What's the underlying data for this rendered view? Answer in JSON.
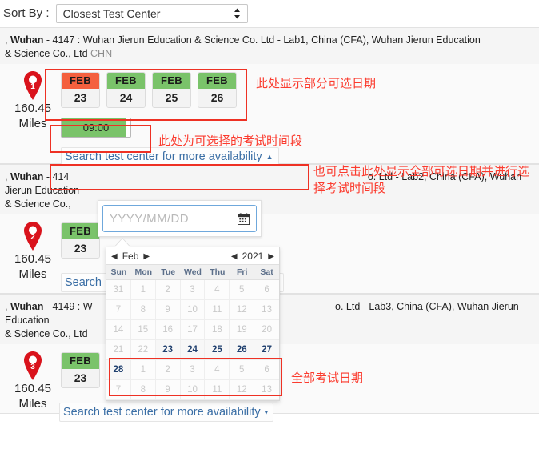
{
  "sort": {
    "label": "Sort By :",
    "selected": "Closest Test Center",
    "options": [
      "Closest Test Center"
    ]
  },
  "centers": [
    {
      "prefix": ", ",
      "city": "Wuhan",
      "code": "4147",
      "name_line1": " - 4147 : Wuhan Jierun Education & Science Co. Ltd - Lab1, China (CFA), Wuhan Jierun Education",
      "name_line2": "& Science Co., Ltd ",
      "country": "CHN",
      "pin_number": "1",
      "distance": "160.45",
      "distance_unit": "Miles",
      "dates": [
        {
          "month": "FEB",
          "day": "23",
          "state": "selected"
        },
        {
          "month": "FEB",
          "day": "24",
          "state": "available"
        },
        {
          "month": "FEB",
          "day": "25",
          "state": "available"
        },
        {
          "month": "FEB",
          "day": "26",
          "state": "available"
        }
      ],
      "times": [
        {
          "label": "09:00",
          "state": "available"
        }
      ],
      "availability_link": "Search test center for more availability",
      "caret": "▲"
    },
    {
      "prefix": ", ",
      "city": "Wuhan",
      "code": "414",
      "name_line1": " - 414",
      "name_line1_tail": "o. Ltd - Lab2, China (CFA), Wuhan Jierun Education",
      "name_line2": "& Science Co., ",
      "pin_number": "2",
      "distance": "160.45",
      "distance_unit": "Miles",
      "dates": [
        {
          "month": "FEB",
          "day": "23",
          "state": "available"
        }
      ],
      "availability_link_partial_left": "Search",
      "availability_link_partial_right": "ty",
      "caret": "▾"
    },
    {
      "prefix": ", ",
      "city": "Wuhan",
      "code": "4149",
      "name_line1": " - 4149 : W",
      "name_line1_tail": "o. Ltd - Lab3, China (CFA), Wuhan Jierun Education",
      "name_line2": "& Science Co., Ltd ",
      "pin_number": "3",
      "distance": "160.45",
      "distance_unit": "Miles",
      "dates": [
        {
          "month": "FEB",
          "day": "23",
          "state": "available"
        }
      ],
      "availability_link": "Search test center for more availability",
      "caret": "▾"
    }
  ],
  "datepicker": {
    "placeholder": "YYYY/MM/DD",
    "value": "",
    "calendar_icon": "calendar-icon",
    "month": "Feb",
    "year": "2021",
    "prev_month_arrow": "◀",
    "next_month_arrow": "▶",
    "prev_year_arrow": "◀",
    "next_year_arrow": "▶",
    "weekdays": [
      "Sun",
      "Mon",
      "Tue",
      "Wed",
      "Thu",
      "Fri",
      "Sat"
    ],
    "weeks": [
      [
        {
          "d": "31",
          "on": false
        },
        {
          "d": "1",
          "on": false
        },
        {
          "d": "2",
          "on": false
        },
        {
          "d": "3",
          "on": false
        },
        {
          "d": "4",
          "on": false
        },
        {
          "d": "5",
          "on": false
        },
        {
          "d": "6",
          "on": false
        }
      ],
      [
        {
          "d": "7",
          "on": false
        },
        {
          "d": "8",
          "on": false
        },
        {
          "d": "9",
          "on": false
        },
        {
          "d": "10",
          "on": false
        },
        {
          "d": "11",
          "on": false
        },
        {
          "d": "12",
          "on": false
        },
        {
          "d": "13",
          "on": false
        }
      ],
      [
        {
          "d": "14",
          "on": false
        },
        {
          "d": "15",
          "on": false
        },
        {
          "d": "16",
          "on": false
        },
        {
          "d": "17",
          "on": false
        },
        {
          "d": "18",
          "on": false
        },
        {
          "d": "19",
          "on": false
        },
        {
          "d": "20",
          "on": false
        }
      ],
      [
        {
          "d": "21",
          "on": false
        },
        {
          "d": "22",
          "on": false
        },
        {
          "d": "23",
          "on": true
        },
        {
          "d": "24",
          "on": true
        },
        {
          "d": "25",
          "on": true
        },
        {
          "d": "26",
          "on": true
        },
        {
          "d": "27",
          "on": true
        }
      ],
      [
        {
          "d": "28",
          "on": true
        },
        {
          "d": "1",
          "on": false
        },
        {
          "d": "2",
          "on": false
        },
        {
          "d": "3",
          "on": false
        },
        {
          "d": "4",
          "on": false
        },
        {
          "d": "5",
          "on": false
        },
        {
          "d": "6",
          "on": false
        }
      ],
      [
        {
          "d": "7",
          "on": false
        },
        {
          "d": "8",
          "on": false
        },
        {
          "d": "9",
          "on": false
        },
        {
          "d": "10",
          "on": false
        },
        {
          "d": "11",
          "on": false
        },
        {
          "d": "12",
          "on": false
        },
        {
          "d": "13",
          "on": false
        }
      ]
    ]
  },
  "annotations": [
    {
      "id": "partial-dates",
      "text": "此处显示部分可选日期"
    },
    {
      "id": "time-slots",
      "text": "此处为可选择的考试时间段"
    },
    {
      "id": "expand-all",
      "text": "也可点击此处显示全部可选日期并进行选择考试时间段"
    },
    {
      "id": "all-dates",
      "text": "全部考试日期"
    }
  ],
  "colors": {
    "selected_date": "#f4603e",
    "available_date": "#7ac36a",
    "available_time": "#7ac36a",
    "annotation_red": "#fb3b2e",
    "link_blue": "#3a6ea5"
  }
}
